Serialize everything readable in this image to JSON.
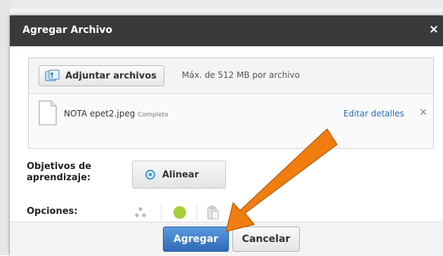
{
  "dialog": {
    "title": "Agregar Archivo",
    "close_glyph": "×"
  },
  "upload": {
    "attach_label": "Adjuntar archivos",
    "max_size": "Máx. de 512 MB por archivo",
    "file": {
      "name": "NOTA epet2.jpeg",
      "status": "Completo",
      "edit_label": "Editar detalles",
      "remove_glyph": "×"
    }
  },
  "objectives": {
    "label": "Objetivos de aprendizaje:",
    "align_label": "Alinear"
  },
  "options": {
    "label": "Opciones:",
    "icons": [
      "share-icon",
      "status-dot-icon",
      "clipboard-icon"
    ],
    "status_color": "#a3cf3c"
  },
  "footer": {
    "add_label": "Agregar",
    "cancel_label": "Cancelar"
  },
  "colors": {
    "titlebar": "#3a3a3a",
    "primary": "#2d6ab5",
    "link": "#2b6cb5",
    "arrow": "#f07d10"
  }
}
